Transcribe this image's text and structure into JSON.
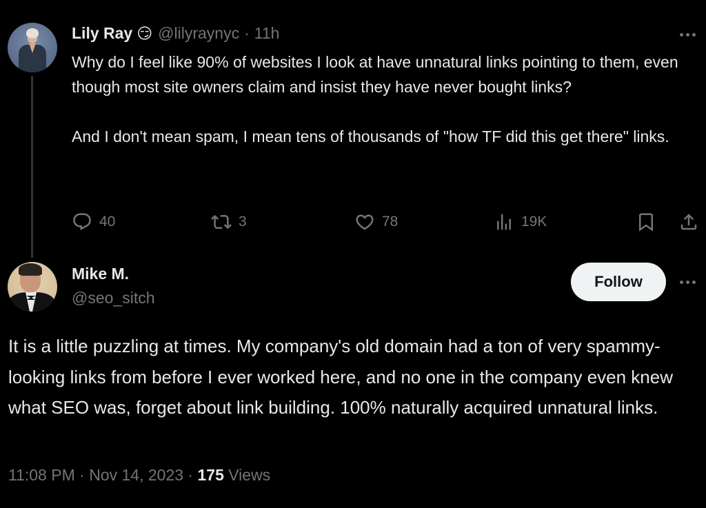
{
  "original_tweet": {
    "author_name": "Lily Ray",
    "author_emoji": "😏",
    "author_handle": "@lilyraynyc",
    "separator": "·",
    "time_ago": "11h",
    "text": "Why do I feel like 90% of websites I look at have unnatural links pointing to them, even though most site owners claim and insist they have never bought links?\n\nAnd I don't mean spam, I mean tens of thousands of \"how TF did this get there\" links.",
    "actions": {
      "reply_icon": "reply-icon",
      "replies": "40",
      "retweet_icon": "retweet-icon",
      "retweets": "3",
      "like_icon": "heart-icon",
      "likes": "78",
      "views_icon": "analytics-icon",
      "views": "19K",
      "bookmark_icon": "bookmark-icon",
      "share_icon": "share-icon"
    },
    "more_icon": "more-horizontal-icon"
  },
  "reply_tweet": {
    "author_name": "Mike M.",
    "author_handle": "@seo_sitch",
    "follow_label": "Follow",
    "more_icon": "more-horizontal-icon",
    "text": "It is a little puzzling at times. My company's old domain had a ton of very spammy-looking links from before I ever worked here, and no one in the company even knew what SEO was, forget about link building. 100% naturally acquired unnatural links.",
    "time": "11:08 PM",
    "separator": "·",
    "date": "Nov 14, 2023",
    "views_count": "175",
    "views_label": "Views"
  },
  "colors": {
    "background": "#000000",
    "text_primary": "#e7e9ea",
    "text_secondary": "#71767b",
    "thread_line": "#333639",
    "follow_bg": "#eff3f4",
    "follow_text": "#0f1419"
  }
}
